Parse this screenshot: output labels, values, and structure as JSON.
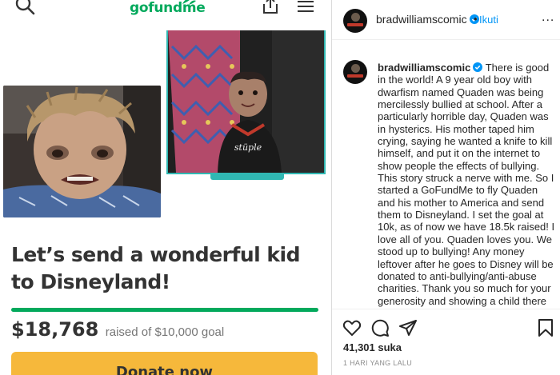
{
  "gofundme": {
    "logo_text": "gofundme",
    "icons": [
      "search-icon",
      "share-icon",
      "menu-icon"
    ],
    "campaign_title": "Let’s send a wonderful kid to Disneyland!",
    "amount_raised": "$18,768",
    "goal_text": "raised of $10,000 goal",
    "progress_fraction": 1.0,
    "donate_label": "Donate now",
    "accent_color": "#02a95c",
    "button_color": "#f6b83b",
    "photo_shirt_text": "stüple"
  },
  "instagram": {
    "username": "bradwilliamscomic",
    "follow_separator": "•",
    "follow_label": "Ikuti",
    "more_label": "...",
    "caption": "There is good in the world! A 9 year old boy with dwarfism named Quaden was being mercilessly bullied at school. After a particularly horrible day, Quaden was in hysterics. His mother taped him crying, saying he wanted a knife to kill himself, and put it on the internet to show people the effects of bullying. This story struck a nerve with me. So I started a GoFundMe to fly Quaden and his mother to America and send them to Disneyland. I set the goal at 10k, as of now we have 18.5k raised! I love all of you. Quaden loves you. We stood up to bullying! Any money leftover after he goes to Disney will be donated to anti-bullying/anti-abuse charities. Thank you so much for your generosity and showing a child there",
    "likes": "41,301 suka",
    "timestamp": "1 HARI YANG LALU",
    "icons": [
      "heart-icon",
      "comment-icon",
      "send-icon",
      "bookmark-icon",
      "verified-icon"
    ],
    "link_color": "#0095f6"
  }
}
